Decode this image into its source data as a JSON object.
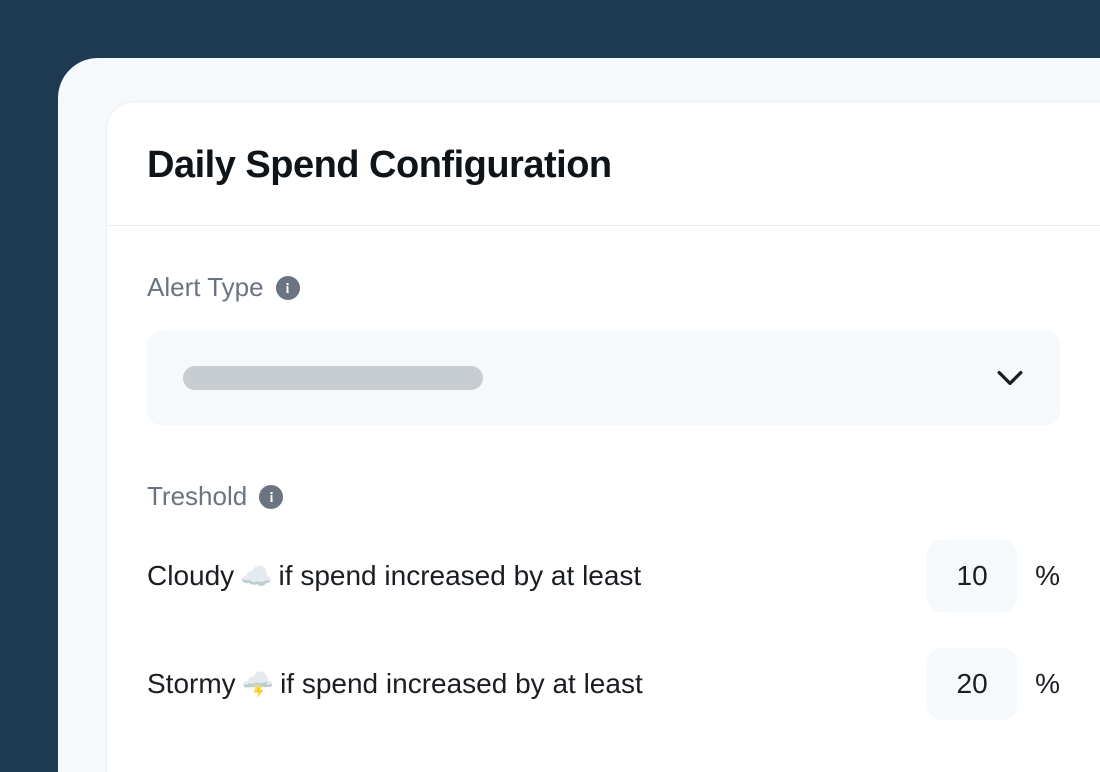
{
  "header": {
    "title": "Daily Spend Configuration"
  },
  "alertType": {
    "label": "Alert Type"
  },
  "threshold": {
    "label": "Treshold",
    "rows": [
      {
        "prefix": "Cloudy",
        "emoji": "☁️",
        "suffix": "if spend increased by at least",
        "value": "10",
        "unit": "%"
      },
      {
        "prefix": "Stormy",
        "emoji": "🌩️",
        "suffix": "if spend increased by at least",
        "value": "20",
        "unit": "%"
      }
    ]
  }
}
